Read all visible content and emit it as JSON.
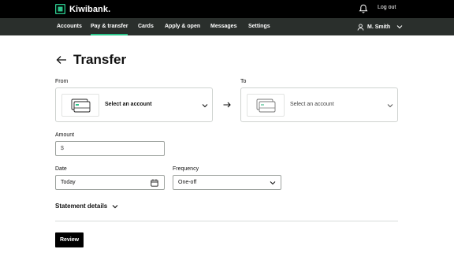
{
  "brand": {
    "name": "Kiwibank.",
    "accent": "#2bc58a"
  },
  "header": {
    "logout_label": "Log out"
  },
  "nav": {
    "items": [
      "Accounts",
      "Pay & transfer",
      "Cards",
      "Apply & open",
      "Messages",
      "Settings"
    ],
    "active": "Pay & transfer",
    "user_name": "M. Smith"
  },
  "page": {
    "title": "Transfer"
  },
  "from": {
    "label": "From",
    "value": "Select an account"
  },
  "to": {
    "label": "To",
    "value": "Select an account"
  },
  "amount": {
    "label": "Amount",
    "placeholder": "$"
  },
  "date": {
    "label": "Date",
    "value": "Today"
  },
  "frequency": {
    "label": "Frequency",
    "value": "One-off"
  },
  "statement": {
    "label": "Statement details"
  },
  "actions": {
    "review_label": "Review"
  }
}
